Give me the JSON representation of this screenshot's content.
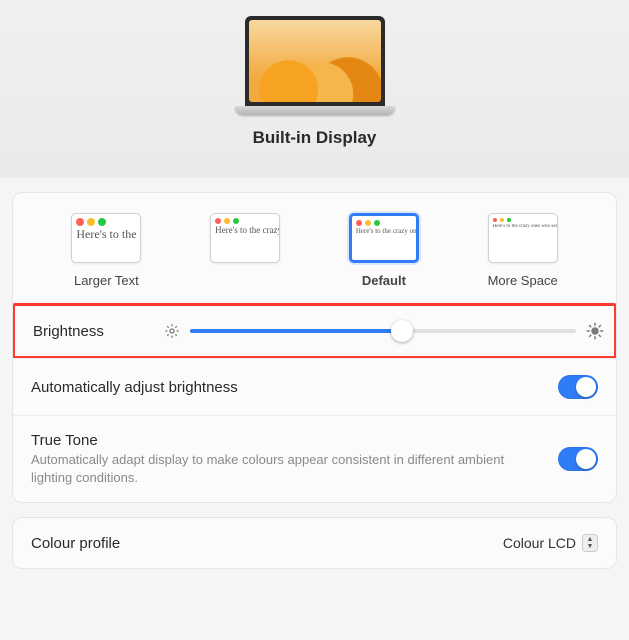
{
  "header": {
    "title": "Built-in Display"
  },
  "resolution": {
    "sample_text": "Here's to the crazy ones who see things differently. The round pegs in the square holes. The troublemakers. The rebels. And they have no rules. They can quote them, disagree with them. About the only thing you can't do is ignore them. Because they change things.",
    "options": [
      {
        "label": "Larger Text",
        "selected": false
      },
      {
        "label": "",
        "selected": false
      },
      {
        "label": "Default",
        "selected": true
      },
      {
        "label": "More Space",
        "selected": false
      }
    ]
  },
  "brightness": {
    "label": "Brightness",
    "value_pct": 55
  },
  "auto_brightness": {
    "label": "Automatically adjust brightness",
    "on": true
  },
  "true_tone": {
    "label": "True Tone",
    "desc": "Automatically adapt display to make colours appear consistent in different ambient lighting conditions.",
    "on": true
  },
  "colour_profile": {
    "label": "Colour profile",
    "value": "Colour LCD"
  }
}
